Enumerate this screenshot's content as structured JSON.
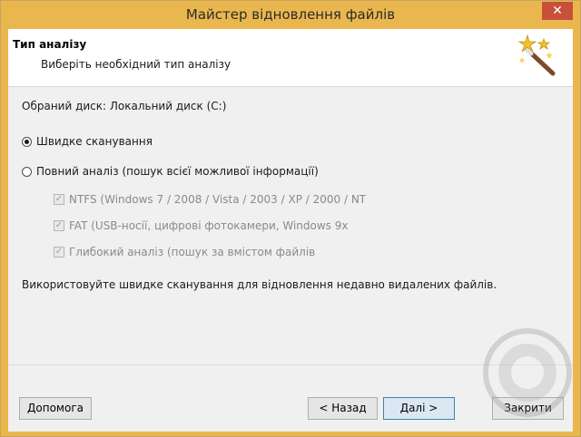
{
  "window": {
    "title": "Майстер відновлення файлів",
    "close_glyph": "✕"
  },
  "header": {
    "title": "Тип аналізу",
    "subtitle": "Виберіть необхідний тип аналізу",
    "icon": "magic-wand-icon"
  },
  "content": {
    "disk_label": "Обраний диск: Локальний диск (C:)",
    "options": [
      {
        "label": "Швидке сканування",
        "selected": true
      },
      {
        "label": "Повний аналіз (пошук всієї можливої інформації)",
        "selected": false
      }
    ],
    "sub_options": [
      {
        "label": "NTFS (Windows 7 / 2008 / Vista / 2003 / XP / 2000 / NT",
        "checked": true
      },
      {
        "label": "FAT (USB-носії, цифрові фотокамери, Windows 9x",
        "checked": true
      },
      {
        "label": "Глибокий аналіз (пошук за вмістом файлів",
        "checked": true
      }
    ],
    "hint": "Використовуйте швидке сканування для відновлення недавно видалених файлів."
  },
  "buttons": {
    "help": "Допомога",
    "back": "< Назад",
    "next": "Далі >",
    "close": "Закрити"
  },
  "colors": {
    "title_bar": "#eab74f",
    "close_button": "#c7503b",
    "accent_border": "#3c7fb1"
  }
}
